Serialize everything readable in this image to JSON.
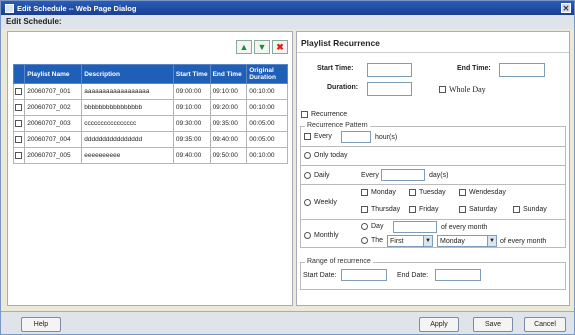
{
  "window": {
    "title": "Edit Schedule -- Web Page Dialog"
  },
  "header": {
    "title": "Edit Schedule:"
  },
  "toolbar": {
    "up_icon": "arrow-up-icon",
    "down_icon": "arrow-down-icon",
    "delete_icon": "delete-icon"
  },
  "table": {
    "columns": [
      "Playlist Name",
      "Description",
      "Start Time",
      "End Time",
      "Original Duration"
    ],
    "rows": [
      [
        "20060707_001",
        "aaaaaaaaaaaaaaaaaa",
        "09:00:00",
        "09:10:00",
        "00:10:00"
      ],
      [
        "20060707_002",
        "bbbbbbbbbbbbbbbb",
        "09:10:00",
        "09:20:00",
        "00:10:00"
      ],
      [
        "20060707_003",
        "cccccccccccccccc",
        "09:30:00",
        "09:35:00",
        "00:05:00"
      ],
      [
        "20060707_004",
        "dddddddddddddddd",
        "09:35:00",
        "09:40:00",
        "00:05:00"
      ],
      [
        "20060707_005",
        "eeeeeeeeee",
        "09:40:00",
        "09:50:00",
        "00:10:00"
      ]
    ]
  },
  "recurrence": {
    "title": "Playlist Recurrence",
    "start_time_label": "Start Time:",
    "end_time_label": "End Time:",
    "duration_label": "Duration:",
    "whole_day_label": "Whole Day",
    "recurrence_label": "Recurrence",
    "pattern_legend": "Recurrence Pattern",
    "every_label": "Every",
    "hours_label": "hour(s)",
    "only_today_label": "Only today",
    "daily_label": "Daily",
    "daily_every_label": "Every",
    "days_label": "day(s)",
    "weekly_label": "Weekly",
    "days": [
      "Monday",
      "Tuesday",
      "Wendesday",
      "Thursday",
      "Friday",
      "Saturday",
      "Sunday"
    ],
    "monthly_label": "Monthly",
    "day_label": "Day",
    "of_every_month_1": "of every month",
    "the_label": "The",
    "ordinal_value": "First",
    "weekday_value": "Monday",
    "of_every_month_2": "of every month",
    "range_legend": "Range of recurrence",
    "start_date_label": "Start Date:",
    "end_date_label": "End Date:"
  },
  "buttons": {
    "help": "Help",
    "apply": "Apply",
    "save": "Save",
    "cancel": "Cancel"
  }
}
